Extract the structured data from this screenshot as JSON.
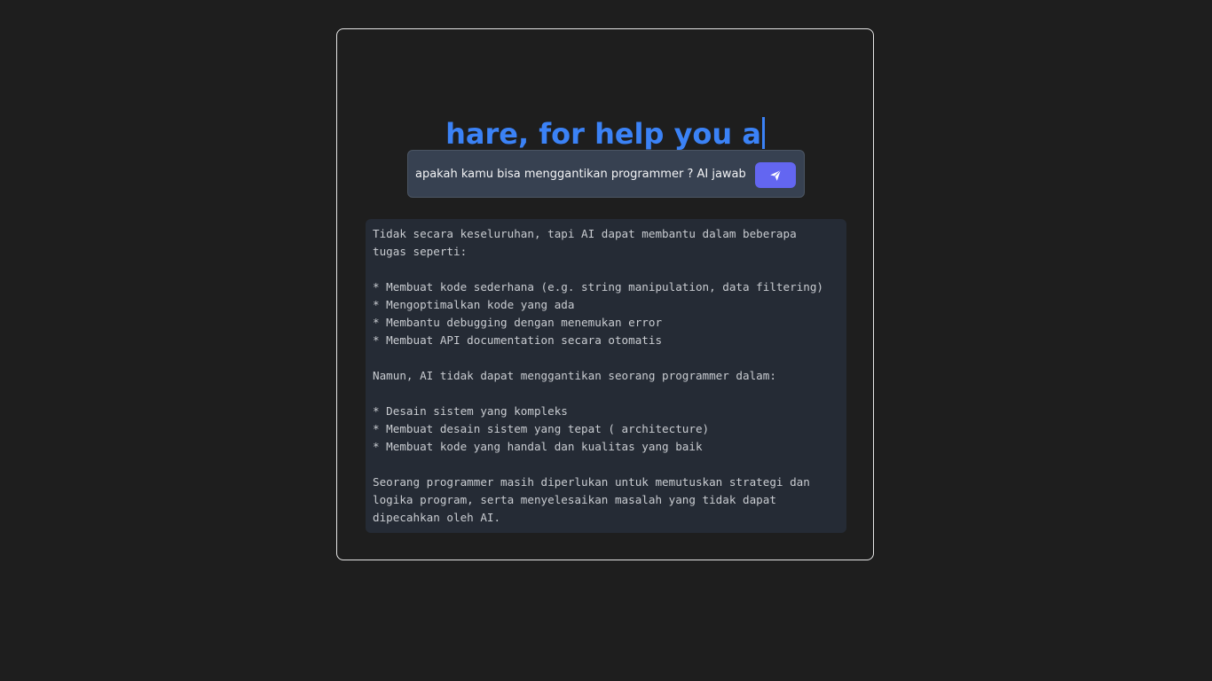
{
  "headline": {
    "text": "hare, for help you a"
  },
  "prompt": {
    "value": "apakah kamu bisa menggantikan programmer ? AI jawab sec",
    "send_icon": "paper-plane-icon"
  },
  "response": {
    "text": "Tidak secara keseluruhan, tapi AI dapat membantu dalam beberapa\ntugas seperti:\n\n* Membuat kode sederhana (e.g. string manipulation, data filtering)\n* Mengoptimalkan kode yang ada\n* Membantu debugging dengan menemukan error\n* Membuat API documentation secara otomatis\n\nNamun, AI tidak dapat menggantikan seorang programmer dalam:\n\n* Desain sistem yang kompleks\n* Membuat desain sistem yang tepat ( architecture)\n* Membuat kode yang handal dan kualitas yang baik\n\nSeorang programmer masih diperlukan untuk memutuskan strategi dan\nlogika program, serta menyelesaikan masalah yang tidak dapat\ndipecahkan oleh AI."
  },
  "colors": {
    "background": "#1e1e1e",
    "accent": "#3b82f6",
    "send_button": "#6366f1",
    "input_bg": "#374151",
    "response_bg": "#252b35"
  }
}
